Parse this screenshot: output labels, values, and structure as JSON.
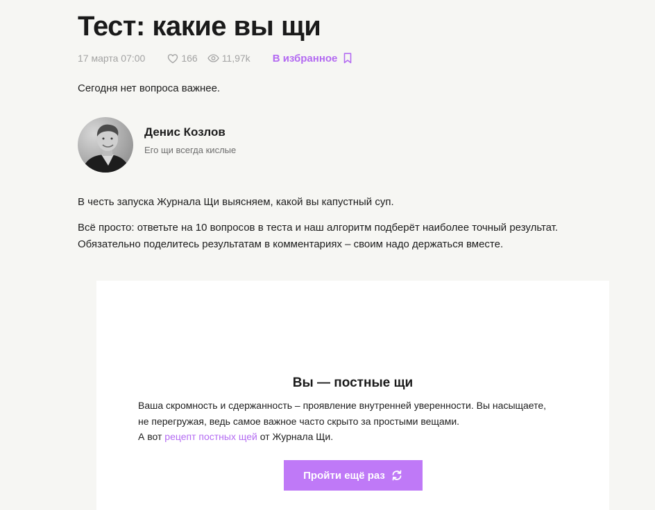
{
  "article": {
    "title": "Тест: какие вы щи",
    "date": "17 марта 07:00",
    "likes": "166",
    "views": "11,97k",
    "favorite_label": "В избранное",
    "lead": "Сегодня нет вопроса важнее.",
    "paragraph_1": "В честь запуска Журнала Щи выясняем, какой вы капустный суп.",
    "paragraph_2_line_1": "Всё просто: ответьте на 10 вопросов в теста и наш алгоритм подберёт наиболее точный результат.",
    "paragraph_2_line_2": "Обязательно поделитесь результатам в комментариях – своим надо держаться вместе."
  },
  "author": {
    "name": "Денис Козлов",
    "description": "Его щи всегда кислые"
  },
  "quiz_result": {
    "title": "Вы — постные щи",
    "line_1": "Ваша скромность и сдержанность – проявление внутренней уверенности. Вы насыщаете,",
    "line_2": "не перегружая, ведь самое важное часто скрыто за простыми вещами.",
    "line_3_prefix": "А вот ",
    "recipe_link": "рецепт постных щей",
    "line_3_suffix": " от Журнала Щи.",
    "retry_label": "Пройти ещё раз"
  },
  "icons": {
    "likes": "heart-icon",
    "views": "eye-icon",
    "favorite": "bookmark-icon",
    "retry": "refresh-icon"
  },
  "colors": {
    "background": "#f6f6f3",
    "accent": "#b36af2",
    "button": "#bf79f7",
    "muted": "#a3a3a3",
    "card": "#ffffff"
  }
}
